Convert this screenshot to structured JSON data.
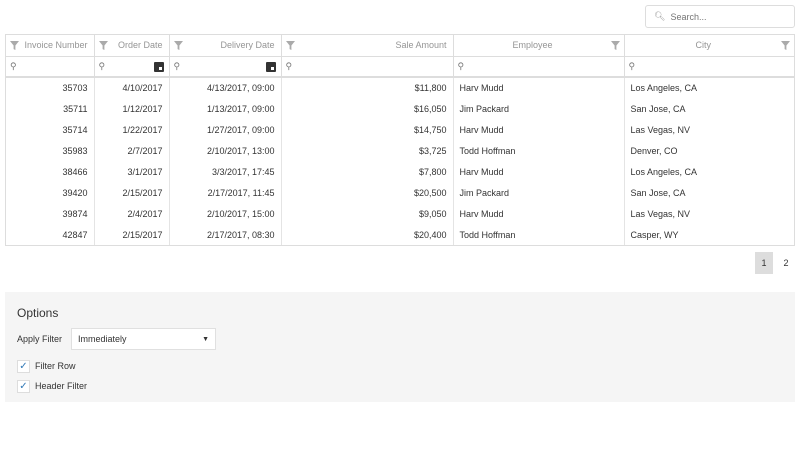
{
  "search": {
    "placeholder": "Search..."
  },
  "columns": [
    "Invoice Number",
    "Order Date",
    "Delivery Date",
    "Sale Amount",
    "Employee",
    "City"
  ],
  "rows": [
    [
      "35703",
      "4/10/2017",
      "4/13/2017, 09:00",
      "$11,800",
      "Harv Mudd",
      "Los Angeles, CA"
    ],
    [
      "35711",
      "1/12/2017",
      "1/13/2017, 09:00",
      "$16,050",
      "Jim Packard",
      "San Jose, CA"
    ],
    [
      "35714",
      "1/22/2017",
      "1/27/2017, 09:00",
      "$14,750",
      "Harv Mudd",
      "Las Vegas, NV"
    ],
    [
      "35983",
      "2/7/2017",
      "2/10/2017, 13:00",
      "$3,725",
      "Todd Hoffman",
      "Denver, CO"
    ],
    [
      "38466",
      "3/1/2017",
      "3/3/2017, 17:45",
      "$7,800",
      "Harv Mudd",
      "Los Angeles, CA"
    ],
    [
      "39420",
      "2/15/2017",
      "2/17/2017, 11:45",
      "$20,500",
      "Jim Packard",
      "San Jose, CA"
    ],
    [
      "39874",
      "2/4/2017",
      "2/10/2017, 15:00",
      "$9,050",
      "Harv Mudd",
      "Las Vegas, NV"
    ],
    [
      "42847",
      "2/15/2017",
      "2/17/2017, 08:30",
      "$20,400",
      "Todd Hoffman",
      "Casper, WY"
    ]
  ],
  "pager": {
    "pages": [
      "1",
      "2"
    ],
    "current": "1"
  },
  "options": {
    "title": "Options",
    "apply_filter_label": "Apply Filter",
    "apply_filter_value": "Immediately",
    "filter_row_label": "Filter Row",
    "filter_row_checked": true,
    "header_filter_label": "Header Filter",
    "header_filter_checked": true
  },
  "colors": {
    "accent": "#337ab7",
    "panel": "#f5f5f5"
  }
}
